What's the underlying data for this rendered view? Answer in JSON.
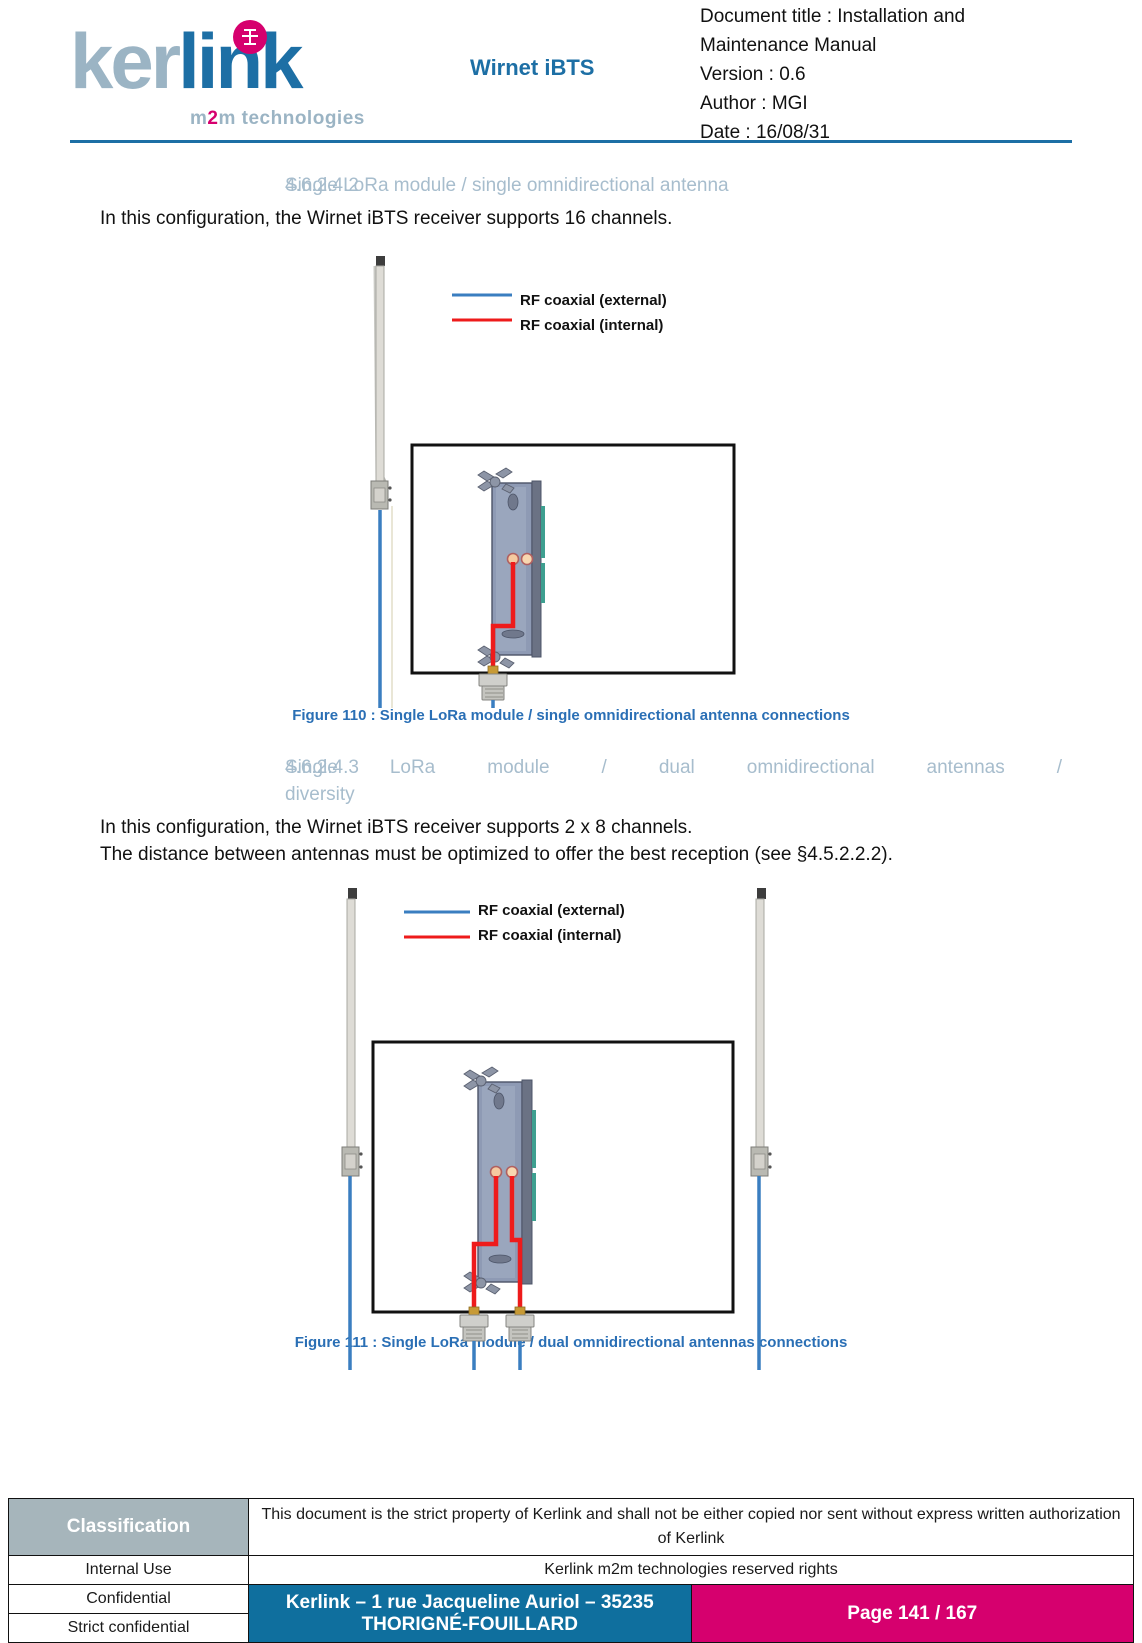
{
  "header": {
    "logo": {
      "part1": "ker",
      "part2": "link",
      "tagline_pre": "m",
      "tagline_two": "2",
      "tagline_post": "m technologies",
      "badge_icon": "kerlink-emblem-icon"
    },
    "product": "Wirnet iBTS",
    "meta": {
      "title_line1": "Document title : Installation and",
      "title_line2": "Maintenance Manual",
      "version": "Version : 0.6",
      "author": "Author : MGI",
      "date": "Date : 16/08/31"
    }
  },
  "sections": [
    {
      "number": "4.6.2.4.2",
      "title": "Single LoRa module / single omnidirectional antenna",
      "body": "In this configuration, the Wirnet iBTS receiver supports 16 channels.",
      "figure": {
        "caption": "Figure 110 : Single LoRa module / single omnidirectional antenna connections",
        "legend": [
          {
            "label": "RF coaxial (external)",
            "color": "#3a7ec0"
          },
          {
            "label": "RF coaxial (internal)",
            "color": "#ee1b1b"
          }
        ]
      }
    },
    {
      "number": "4.6.2.4.3",
      "title": "Single LoRa module / dual omnidirectional antennas /",
      "title_line2": "diversity",
      "body": "In this configuration, the Wirnet iBTS receiver supports 2 x 8 channels.",
      "body2": "The distance between antennas must be optimized to offer the best reception (see §4.5.2.2.2).",
      "figure": {
        "caption": "Figure 111 : Single LoRa module / dual omnidirectional antennas connections",
        "legend": [
          {
            "label": "RF coaxial (external)",
            "color": "#3a7ec0"
          },
          {
            "label": "RF coaxial (internal)",
            "color": "#ee1b1b"
          }
        ]
      }
    }
  ],
  "footer": {
    "classification_header": "Classification",
    "levels": [
      "Internal Use",
      "Confidential",
      "Strict confidential"
    ],
    "legal_text": "This document is the strict property of Kerlink and shall not be either copied nor sent without express written authorization of Kerlink",
    "rights_text": "Kerlink m2m technologies reserved rights",
    "address": "Kerlink – 1 rue Jacqueline Auriol – 35235 THORIGNÉ-FOUILLARD",
    "page": "Page 141 / 167"
  },
  "colors": {
    "accent_blue": "#1d6fa5",
    "magenta": "#d6006e",
    "heading_gray": "#a7bdcd",
    "caption_blue": "#2a6fb5",
    "classification_gray": "#a6b5bb"
  }
}
